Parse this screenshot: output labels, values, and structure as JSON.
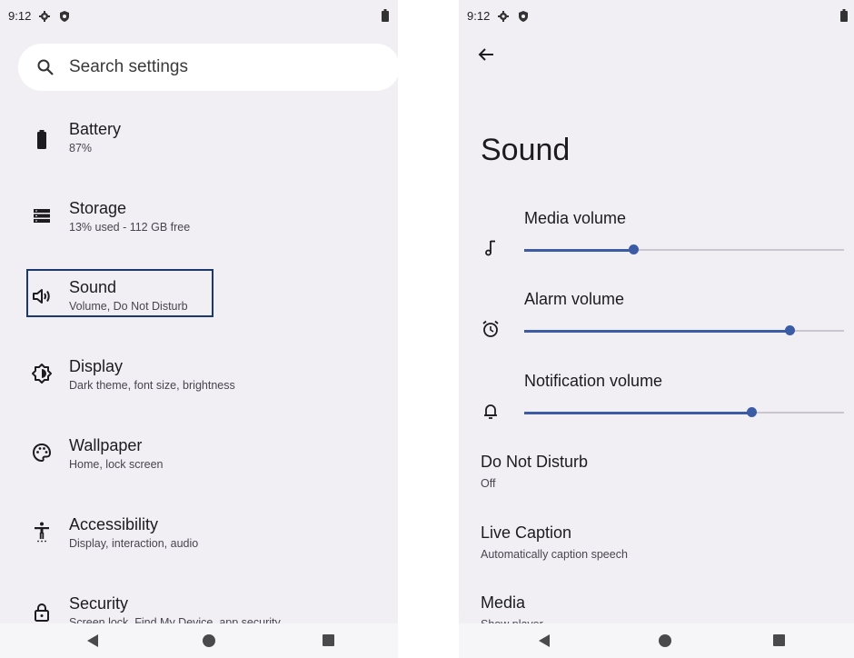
{
  "left": {
    "status": {
      "time": "9:12"
    },
    "search": {
      "placeholder": "Search settings"
    },
    "items": [
      {
        "title": "Battery",
        "sub": "87%",
        "icon": "battery-icon"
      },
      {
        "title": "Storage",
        "sub": "13% used - 112 GB free",
        "icon": "storage-icon"
      },
      {
        "title": "Sound",
        "sub": "Volume, Do Not Disturb",
        "icon": "speaker-icon"
      },
      {
        "title": "Display",
        "sub": "Dark theme, font size, brightness",
        "icon": "display-icon"
      },
      {
        "title": "Wallpaper",
        "sub": "Home, lock screen",
        "icon": "palette-icon"
      },
      {
        "title": "Accessibility",
        "sub": "Display, interaction, audio",
        "icon": "accessibility-icon"
      },
      {
        "title": "Security",
        "sub": "Screen lock, Find My Device, app security",
        "icon": "lock-icon"
      }
    ]
  },
  "right": {
    "status": {
      "time": "9:12"
    },
    "title": "Sound",
    "volumes": [
      {
        "label": "Media volume",
        "level": 0.34,
        "icon": "music-note-icon"
      },
      {
        "label": "Alarm volume",
        "level": 0.83,
        "icon": "alarm-icon"
      },
      {
        "label": "Notification volume",
        "level": 0.71,
        "icon": "bell-icon"
      }
    ],
    "items": [
      {
        "title": "Do Not Disturb",
        "sub": "Off"
      },
      {
        "title": "Live Caption",
        "sub": "Automatically caption speech"
      },
      {
        "title": "Media",
        "sub": "Show player"
      }
    ]
  },
  "colors": {
    "accent": "#3b5ba5",
    "highlight_border": "#1b3a6b",
    "background": "#f1eff4"
  }
}
